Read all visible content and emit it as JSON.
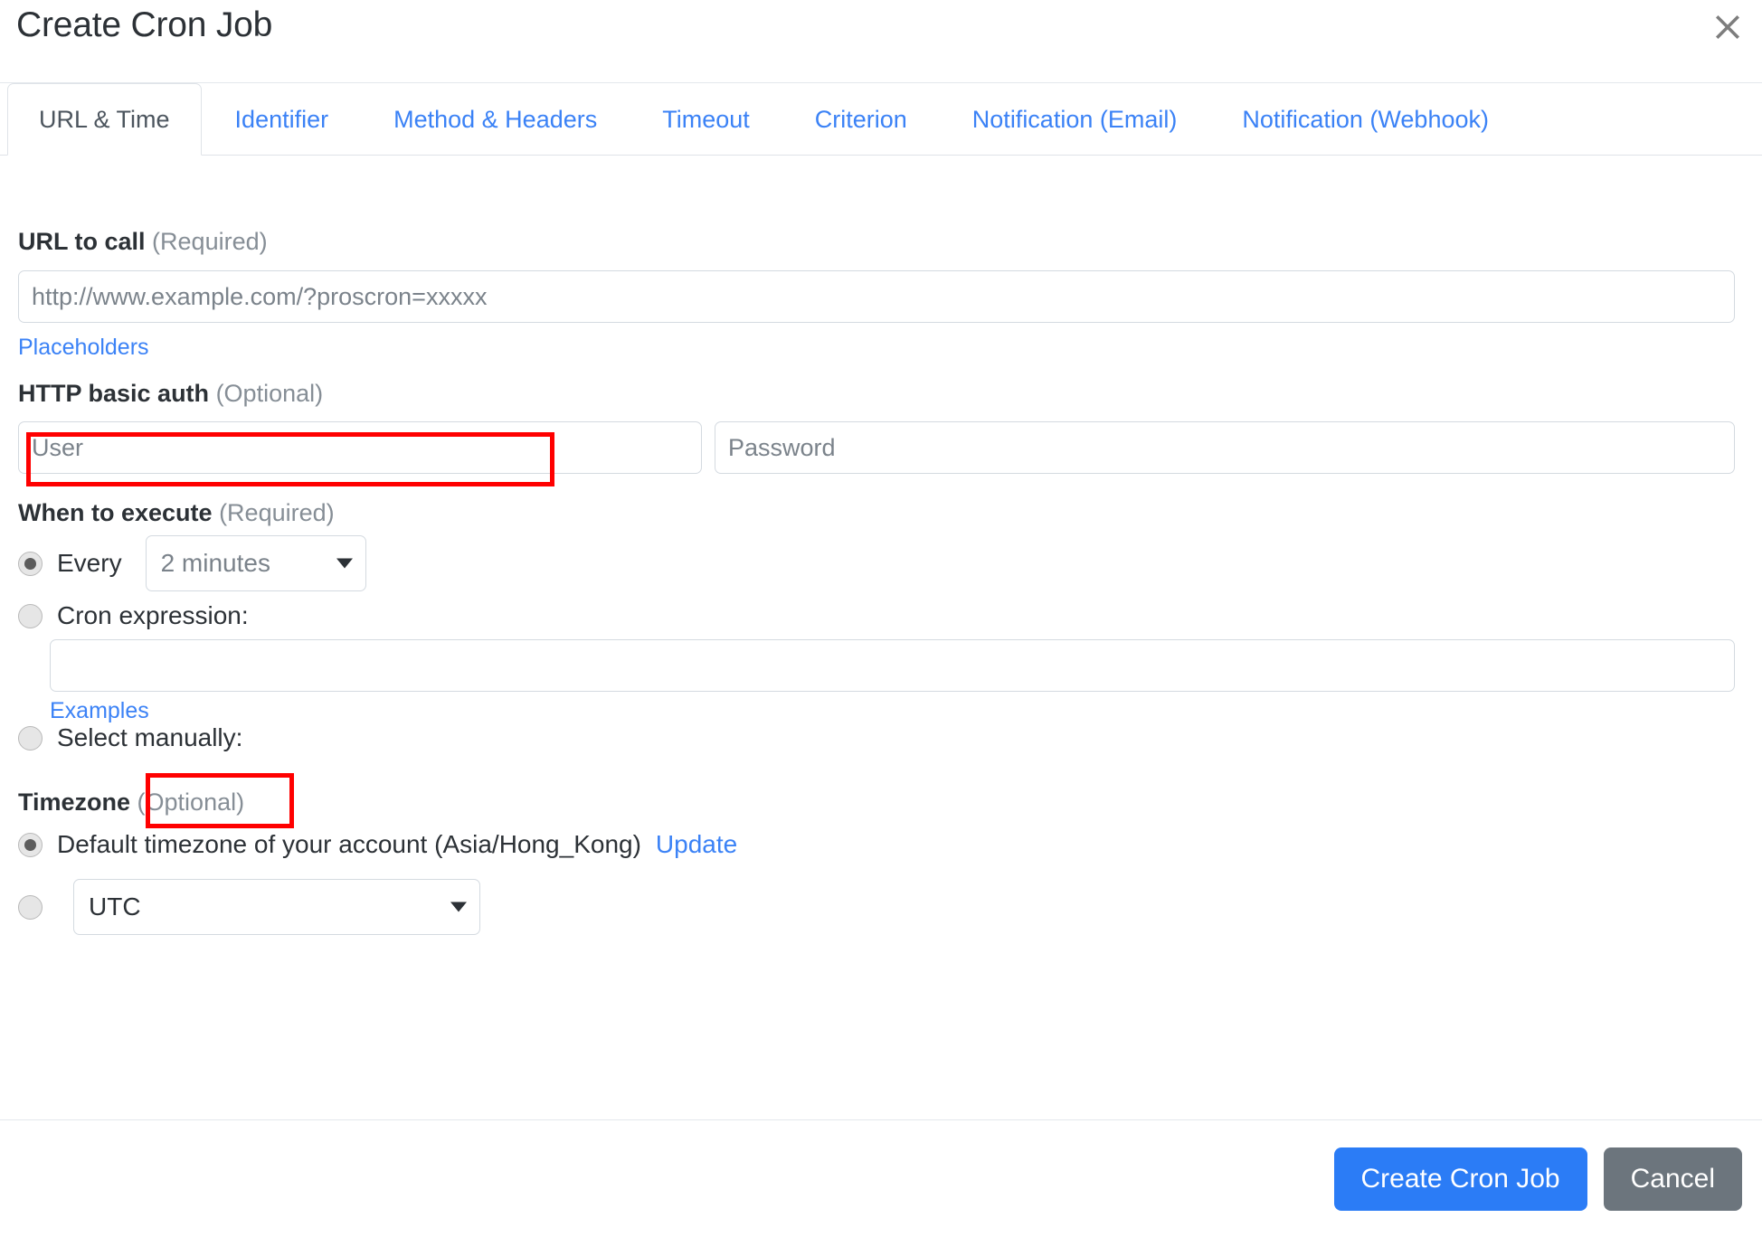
{
  "dialog": {
    "title": "Create Cron Job",
    "close_icon": "close-icon"
  },
  "tabs": [
    {
      "label": "URL & Time",
      "active": true
    },
    {
      "label": "Identifier",
      "active": false
    },
    {
      "label": "Method & Headers",
      "active": false
    },
    {
      "label": "Timeout",
      "active": false
    },
    {
      "label": "Criterion",
      "active": false
    },
    {
      "label": "Notification (Email)",
      "active": false
    },
    {
      "label": "Notification (Webhook)",
      "active": false
    }
  ],
  "url_section": {
    "label": "URL to call",
    "label_suffix": "(Required)",
    "input_placeholder": "http://www.example.com/?proscron=xxxxx",
    "input_value": "",
    "placeholders_link": "Placeholders"
  },
  "auth_section": {
    "label": "HTTP basic auth",
    "label_suffix": "(Optional)",
    "user_placeholder": "User",
    "user_value": "",
    "password_placeholder": "Password",
    "password_value": ""
  },
  "schedule_section": {
    "label": "When to execute",
    "label_suffix": "(Required)",
    "every_label": "Every",
    "every_selected": "2 minutes",
    "every_checked": true,
    "cron_label": "Cron expression:",
    "cron_checked": false,
    "cron_value": "",
    "examples_link": "Examples",
    "manual_label": "Select manually:",
    "manual_checked": false
  },
  "timezone_section": {
    "label": "Timezone",
    "label_suffix": "(Optional)",
    "default_label": "Default timezone of your account (Asia/Hong_Kong)",
    "update_link": "Update",
    "default_checked": true,
    "custom_selected": "UTC",
    "custom_checked": false
  },
  "footer": {
    "submit_label": "Create Cron Job",
    "cancel_label": "Cancel"
  },
  "colors": {
    "link": "#3b82f6",
    "primary_button": "#2b7cf6",
    "secondary_button": "#6c757d",
    "annotation": "#ff0000"
  }
}
